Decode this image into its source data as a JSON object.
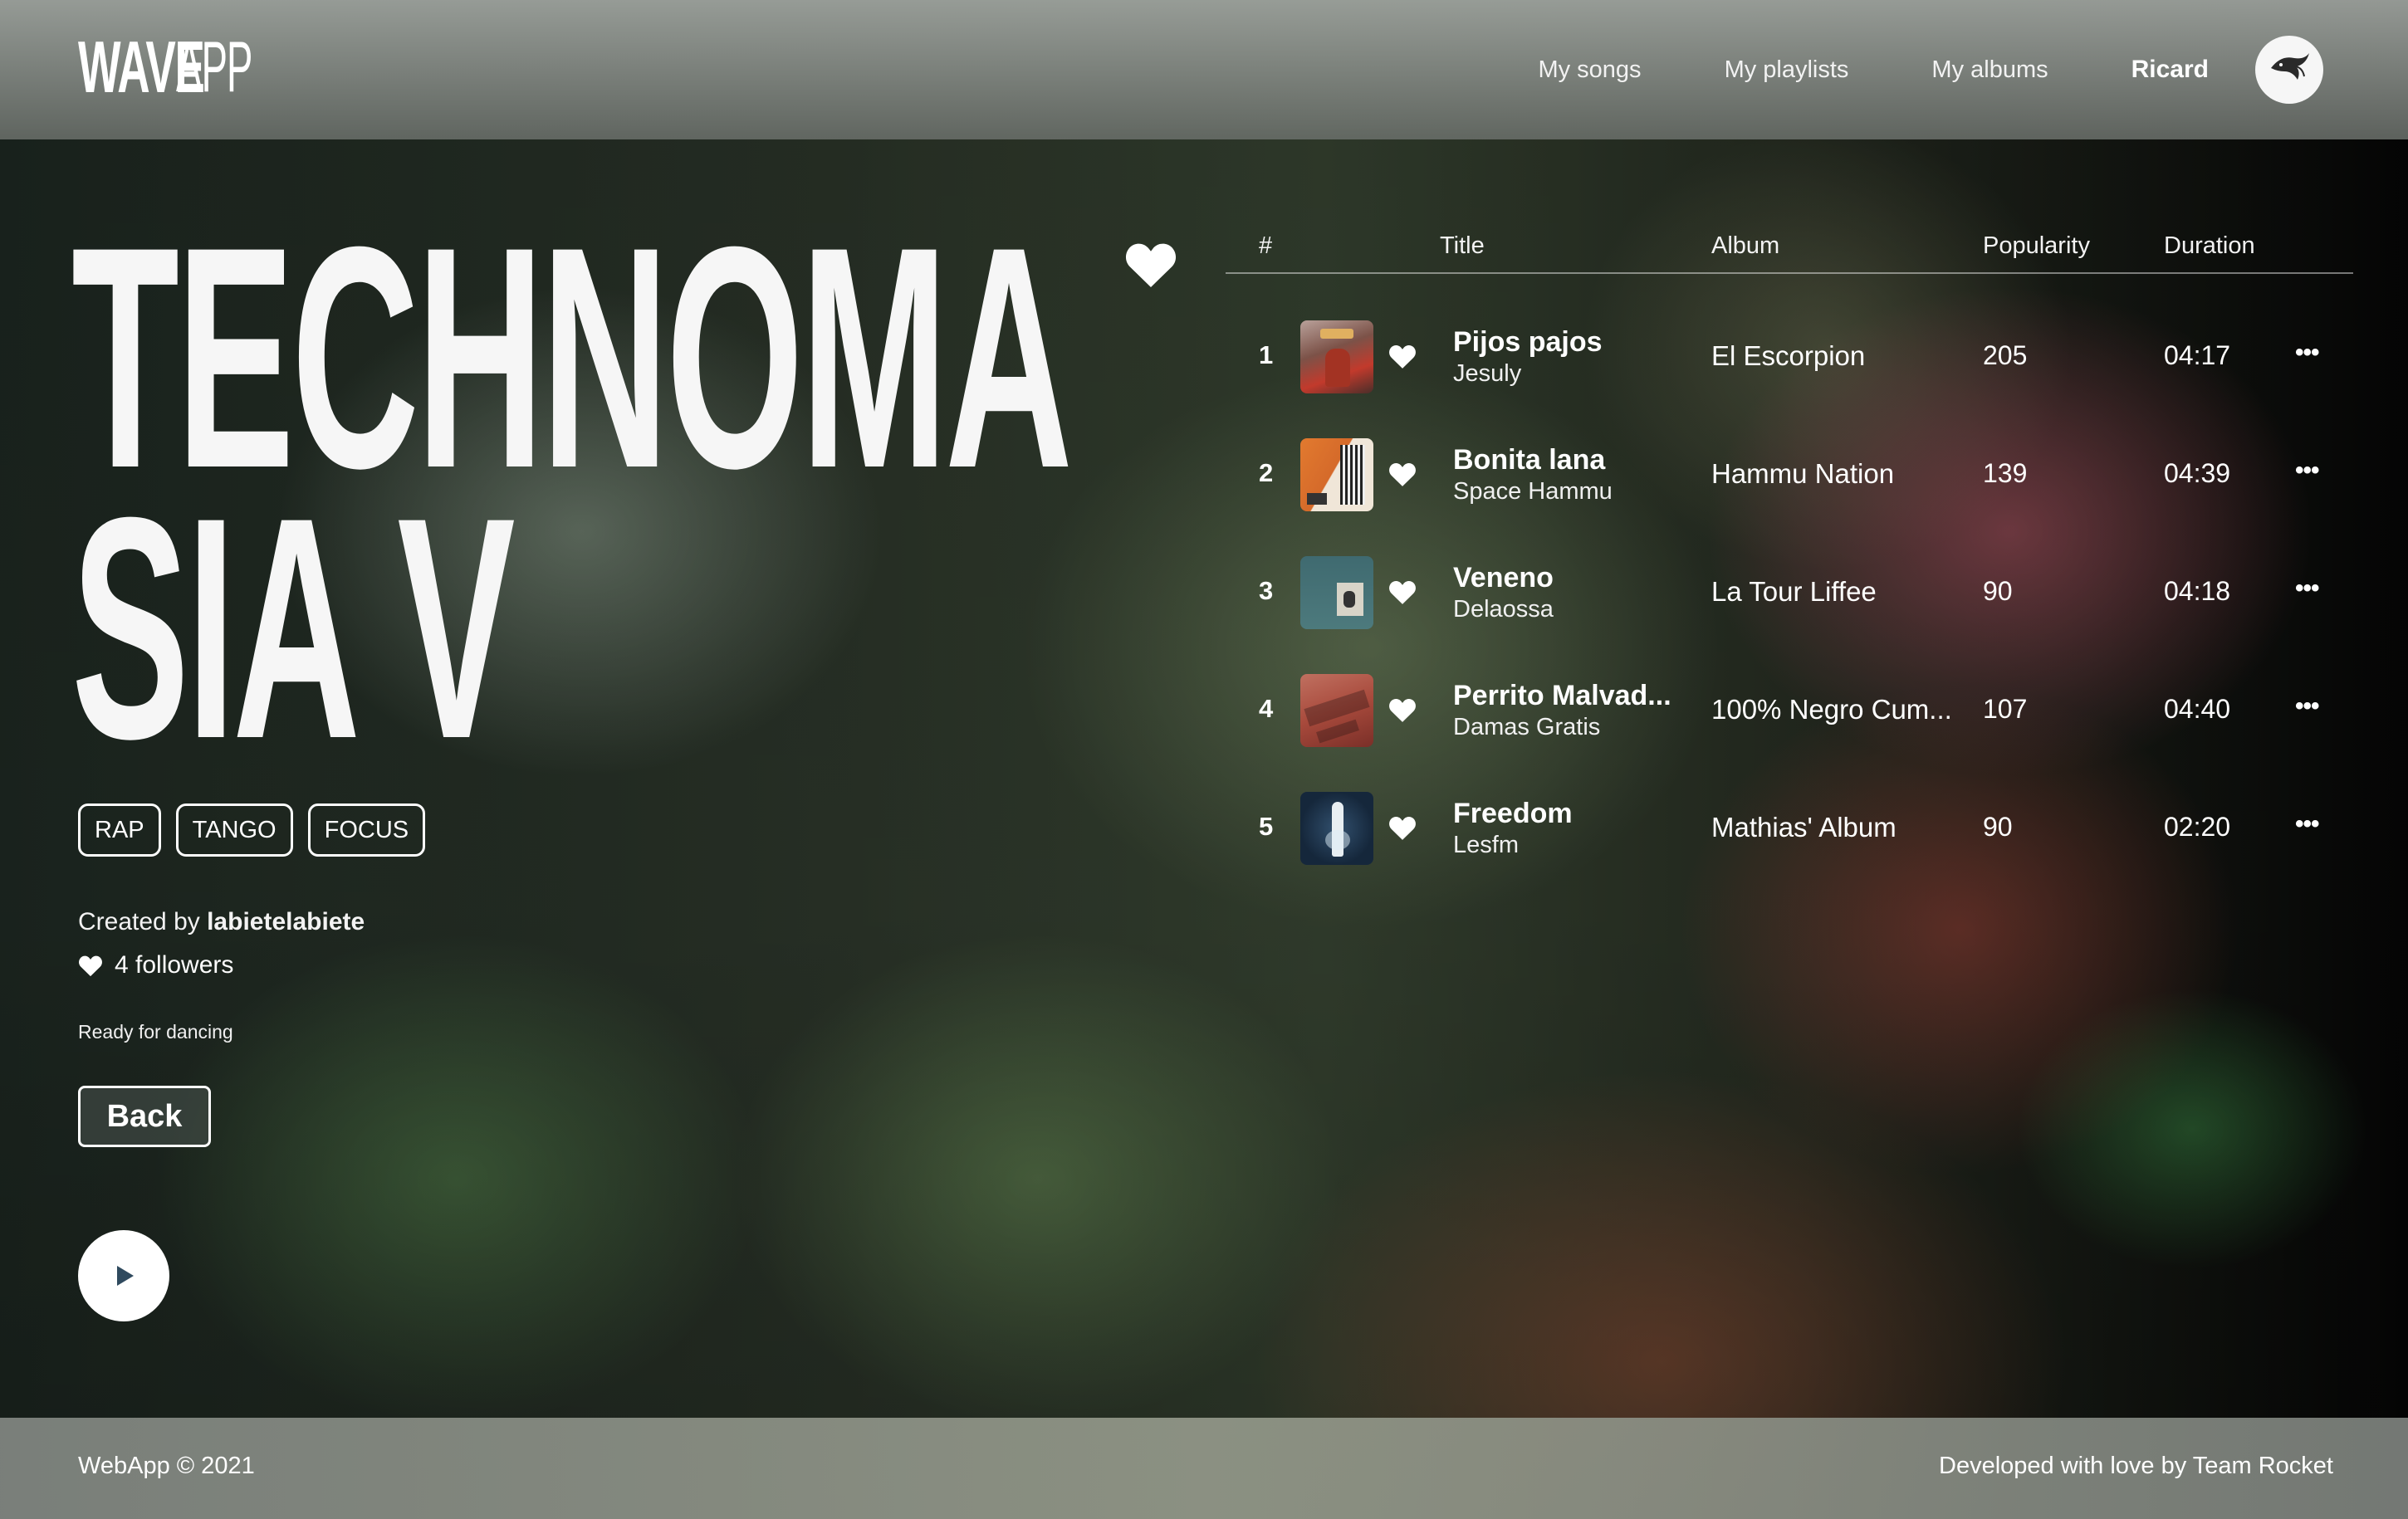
{
  "header": {
    "logo_bold": "WAVE",
    "logo_thin": "APP",
    "nav": [
      "My songs",
      "My playlists",
      "My albums"
    ],
    "user": "Ricard"
  },
  "playlist": {
    "title_line1": "TECHNOMA",
    "title_line2": "SIA V",
    "tags": [
      "RAP",
      "TANGO",
      "FOCUS"
    ],
    "created_prefix": "Created by",
    "creator": "labietelabiete",
    "followers": "4 followers",
    "description": "Ready for dancing",
    "back_label": "Back"
  },
  "table": {
    "headers": {
      "num": "#",
      "title": "Title",
      "album": "Album",
      "popularity": "Popularity",
      "duration": "Duration"
    },
    "rows": [
      {
        "num": "1",
        "title": "Pijos pajos",
        "artist": "Jesuly",
        "album": "El Escorpion",
        "popularity": "205",
        "duration": "04:17"
      },
      {
        "num": "2",
        "title": "Bonita lana",
        "artist": "Space Hammu",
        "album": "Hammu Nation",
        "popularity": "139",
        "duration": "04:39"
      },
      {
        "num": "3",
        "title": "Veneno",
        "artist": "Delaossa",
        "album": "La Tour Liffee",
        "popularity": "90",
        "duration": "04:18"
      },
      {
        "num": "4",
        "title": "Perrito Malvad...",
        "artist": "Damas Gratis",
        "album": "100% Negro Cum...",
        "popularity": "107",
        "duration": "04:40"
      },
      {
        "num": "5",
        "title": "Freedom",
        "artist": "Lesfm",
        "album": "Mathias' Album",
        "popularity": "90",
        "duration": "02:20"
      }
    ],
    "more_label": "•••"
  },
  "footer": {
    "left": "WebApp © 2021",
    "right": "Developed with love by Team Rocket"
  },
  "colors": {
    "text": "#ffffff",
    "play_icon": "#2f4a5e"
  },
  "icons": [
    "heart-icon",
    "play-icon",
    "more-icon",
    "avatar-bird-icon"
  ]
}
